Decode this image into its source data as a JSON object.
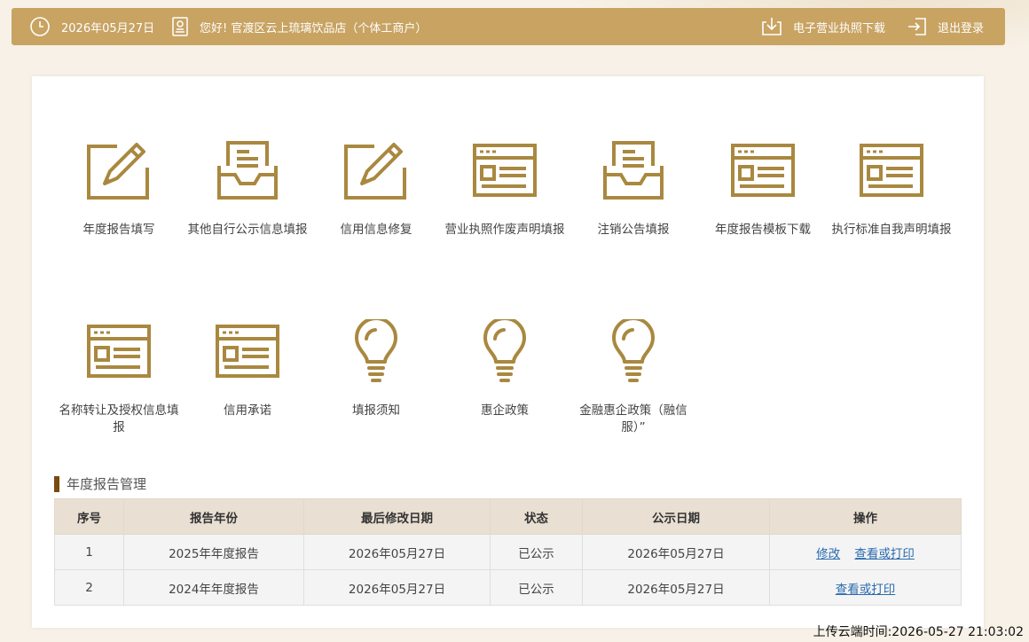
{
  "header": {
    "date": "2026年05月27日",
    "greeting": "您好! 官渡区云上琉璃饮品店（个体工商户）",
    "download_license": "电子营业执照下载",
    "logout": "退出登录",
    "bg_color": "#c8a362"
  },
  "tiles": [
    {
      "label": "年度报告填写",
      "icon": "pencil-paper-icon"
    },
    {
      "label": "其他自行公示信息填报",
      "icon": "inbox-document-icon"
    },
    {
      "label": "信用信息修复",
      "icon": "pencil-paper-icon"
    },
    {
      "label": "营业执照作废声明填报",
      "icon": "browser-window-icon"
    },
    {
      "label": "注销公告填报",
      "icon": "inbox-document-icon"
    },
    {
      "label": "年度报告模板下载",
      "icon": "browser-window-icon"
    },
    {
      "label": "执行标准自我声明填报",
      "icon": "browser-window-icon"
    },
    {
      "label": "名称转让及授权信息填报",
      "icon": "browser-window-icon"
    },
    {
      "label": "信用承诺",
      "icon": "browser-window-icon"
    },
    {
      "label": "填报须知",
      "icon": "lightbulb-icon"
    },
    {
      "label": "惠企政策",
      "icon": "lightbulb-icon"
    },
    {
      "label": "金融惠企政策（融信服）”",
      "icon": "lightbulb-icon"
    }
  ],
  "section": {
    "title": "年度报告管理",
    "accent": "#7a4a0e"
  },
  "table": {
    "headers": [
      "序号",
      "报告年份",
      "最后修改日期",
      "状态",
      "公示日期",
      "操作"
    ],
    "rows": [
      {
        "no": "1",
        "year": "2025年年度报告",
        "modified": "2026年05月27日",
        "status": "已公示",
        "published": "2026年05月27日",
        "actions": [
          "修改",
          "查看或打印"
        ]
      },
      {
        "no": "2",
        "year": "2024年年度报告",
        "modified": "2026年05月27日",
        "status": "已公示",
        "published": "2026年05月27日",
        "actions": [
          "查看或打印"
        ]
      }
    ]
  },
  "footer": {
    "upload_time": "上传云端时间:2026-05-27 21:03:02"
  },
  "colors": {
    "icon_gold": "#a9883f",
    "link_blue": "#2b6cb0"
  }
}
